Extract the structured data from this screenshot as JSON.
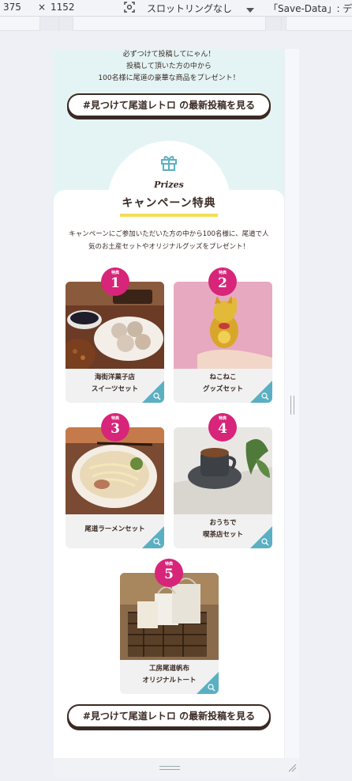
{
  "devtools": {
    "width": "375",
    "close_symbol": "×",
    "height": "1152",
    "throttle": "スロットリングなし",
    "save_data": "「Save-Data」: デフ"
  },
  "intro": {
    "lines": [
      "必ずつけて投稿してにゃん！",
      "投稿して頂いた方の中から",
      "100名様に尾道の豪華な商品をプレゼント！"
    ]
  },
  "cta": {
    "label": "#見つけて尾道レトロ の最新投稿を見る"
  },
  "prizes": {
    "script_title": "Prizes",
    "title": "キャンペーン特典",
    "description": "キャンペーンにご参加いただいた方の中から100名様に、尾道で人気のお土産セットやオリジナルグッズをプレゼント！",
    "badge_label": "特典",
    "items": [
      {
        "num": "1",
        "line1": "海街洋菓子店",
        "line2": "スイーツセット",
        "icon": "sweets-photo"
      },
      {
        "num": "2",
        "line1": "ねこねこ",
        "line2": "グッズセット",
        "icon": "lucky-cat-photo"
      },
      {
        "num": "3",
        "line1": "尾道ラーメンセット",
        "line2": "",
        "icon": "ramen-photo"
      },
      {
        "num": "4",
        "line1": "おうちで",
        "line2": "喫茶店セット",
        "icon": "coffee-photo"
      },
      {
        "num": "5",
        "line1": "工房尾道帆布",
        "line2": "オリジナルトート",
        "icon": "tote-photo"
      }
    ]
  },
  "colors": {
    "mint": "#e4f4f4",
    "magenta": "#d7257a",
    "teal": "#5ab0c2",
    "yellow": "#f5dd56",
    "brown": "#3a2a24"
  }
}
